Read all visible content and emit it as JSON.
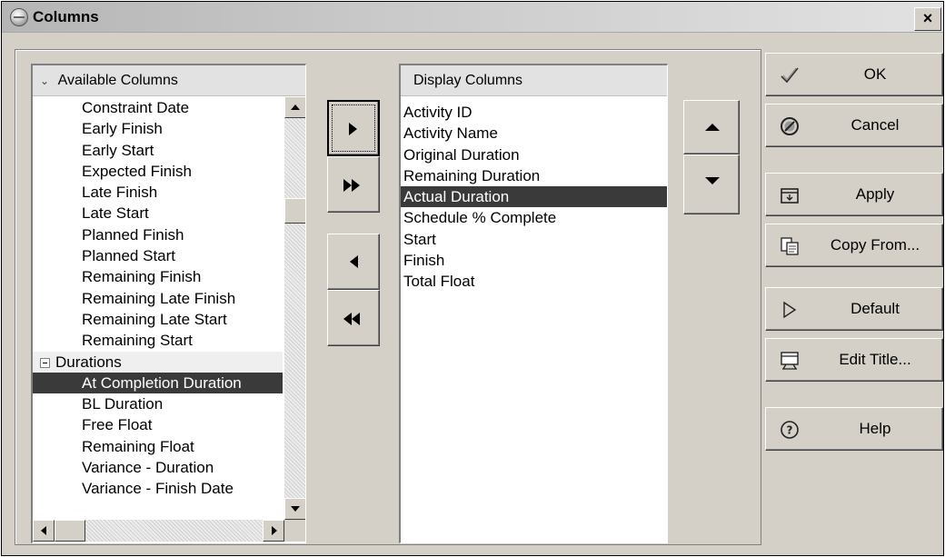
{
  "window": {
    "title": "Columns",
    "close_glyph": "×"
  },
  "available": {
    "header": "Available Columns",
    "header_icon": "chevron-down-icon",
    "items": [
      {
        "label": "Constraint Date",
        "type": "item"
      },
      {
        "label": "Early Finish",
        "type": "item"
      },
      {
        "label": "Early Start",
        "type": "item"
      },
      {
        "label": "Expected Finish",
        "type": "item"
      },
      {
        "label": "Late Finish",
        "type": "item"
      },
      {
        "label": "Late Start",
        "type": "item"
      },
      {
        "label": "Planned Finish",
        "type": "item"
      },
      {
        "label": "Planned Start",
        "type": "item"
      },
      {
        "label": "Remaining Finish",
        "type": "item"
      },
      {
        "label": "Remaining Late Finish",
        "type": "item"
      },
      {
        "label": "Remaining Late Start",
        "type": "item"
      },
      {
        "label": "Remaining Start",
        "type": "item"
      },
      {
        "label": "Durations",
        "type": "group"
      },
      {
        "label": "At Completion Duration",
        "type": "item",
        "selected": true
      },
      {
        "label": "BL Duration",
        "type": "item"
      },
      {
        "label": "Free Float",
        "type": "item"
      },
      {
        "label": "Remaining Float",
        "type": "item"
      },
      {
        "label": "Variance - Duration",
        "type": "item"
      },
      {
        "label": "Variance - Finish Date",
        "type": "item"
      }
    ]
  },
  "display": {
    "header": "Display Columns",
    "items": [
      {
        "label": "Activity ID"
      },
      {
        "label": "Activity Name"
      },
      {
        "label": "Original Duration"
      },
      {
        "label": "Remaining Duration"
      },
      {
        "label": "Actual Duration",
        "selected": true
      },
      {
        "label": "Schedule % Complete"
      },
      {
        "label": "Start"
      },
      {
        "label": "Finish"
      },
      {
        "label": "Total Float"
      }
    ]
  },
  "transfer_buttons": [
    {
      "name": "add-selected-button",
      "icon": "arrow-right-icon"
    },
    {
      "name": "add-all-button",
      "icon": "double-arrow-right-icon"
    },
    {
      "name": "remove-selected-button",
      "icon": "arrow-left-icon"
    },
    {
      "name": "remove-all-button",
      "icon": "double-arrow-left-icon"
    }
  ],
  "order_buttons": [
    {
      "name": "move-up-button",
      "icon": "triangle-up-icon"
    },
    {
      "name": "move-down-button",
      "icon": "triangle-down-icon"
    }
  ],
  "commands": {
    "ok": {
      "label": "OK",
      "icon": "checkmark-icon"
    },
    "cancel": {
      "label": "Cancel",
      "icon": "cancel-icon"
    },
    "apply": {
      "label": "Apply",
      "icon": "apply-icon"
    },
    "copy_from": {
      "label": "Copy From...",
      "icon": "copy-icon"
    },
    "default": {
      "label": "Default",
      "icon": "play-outline-icon"
    },
    "edit_title": {
      "label": "Edit Title...",
      "icon": "edit-title-icon"
    },
    "help": {
      "label": "Help",
      "icon": "help-icon"
    }
  },
  "colors": {
    "dialog_bg": "#d4d0c8",
    "selection_bg": "#3a3a3a",
    "selection_text": "#ffffff"
  }
}
